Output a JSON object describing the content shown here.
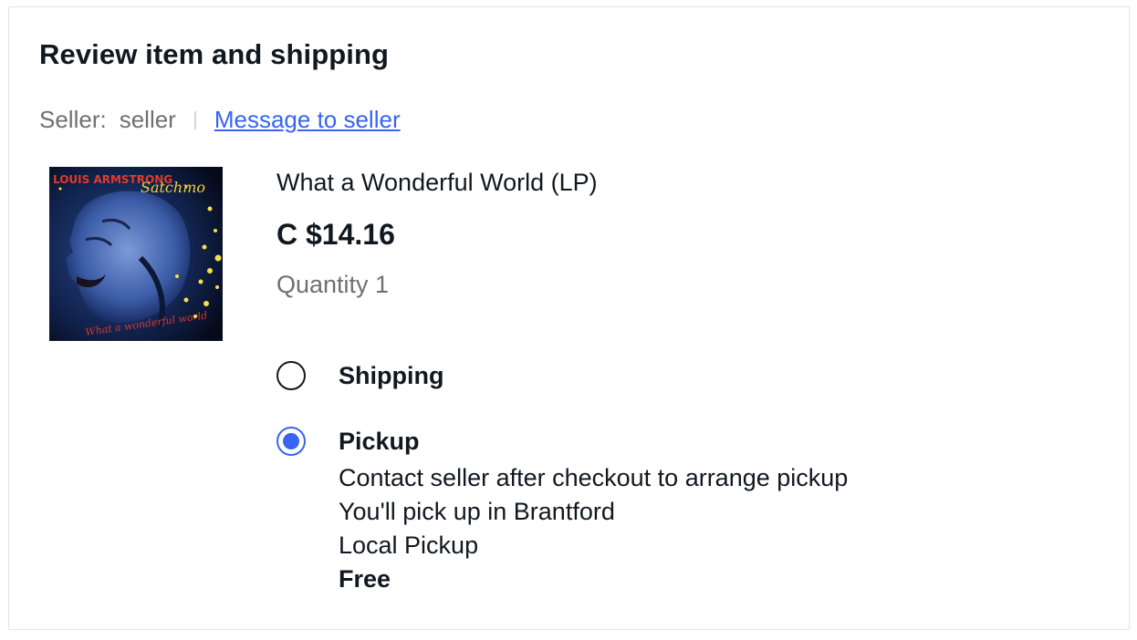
{
  "section": {
    "title": "Review item and shipping"
  },
  "seller": {
    "label": "Seller:",
    "name": "seller",
    "message_link": "Message to seller"
  },
  "item": {
    "image_alt": "Louis Armstrong Satchmo album cover",
    "cover_artist_text": "LOUIS ARMSTRONG",
    "cover_logo_text": "Satchmo",
    "cover_subtitle_text": "What a wonderful world",
    "title": "What a Wonderful World (LP)",
    "price": "C $14.16",
    "quantity": "Quantity 1"
  },
  "delivery_options": {
    "shipping": {
      "label": "Shipping",
      "selected": false
    },
    "pickup": {
      "label": "Pickup",
      "selected": true,
      "line1": "Contact seller after checkout to arrange pickup",
      "line2": "You'll pick up in Brantford",
      "line3": "Local Pickup",
      "cost": "Free"
    }
  },
  "colors": {
    "link": "#3665f3",
    "radio_selected": "#3665f3",
    "muted_text": "#707070"
  }
}
